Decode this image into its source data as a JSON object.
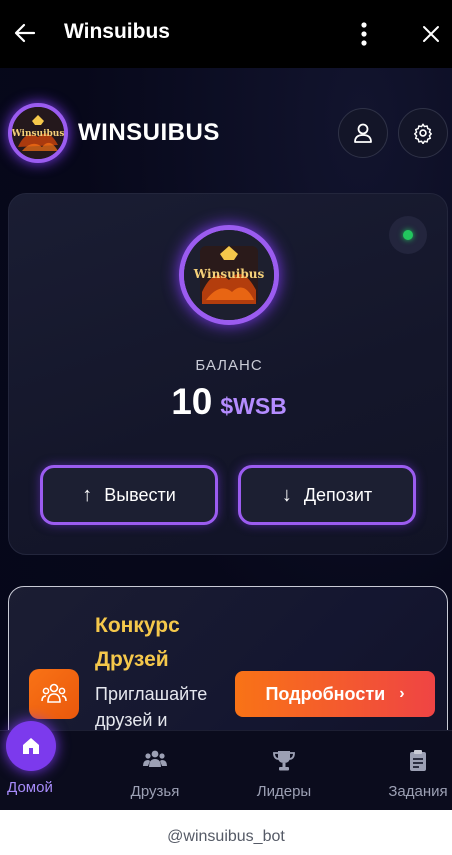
{
  "topbar": {
    "title": "Winsuibus",
    "back_icon": "arrow-left-icon",
    "more_icon": "more-vertical-icon",
    "close_icon": "close-icon"
  },
  "header": {
    "brand_name": "WINSUIBUS",
    "logo_icon": "winsuibus-logo",
    "logo_text": "Winsuibus",
    "profile_icon": "user-icon",
    "settings_icon": "gear-icon"
  },
  "balance": {
    "label": "БАЛАНС",
    "amount": "10",
    "currency": "$WSB",
    "status_color": "#22c55e",
    "withdraw_label": "Вывести",
    "deposit_label": "Депозит"
  },
  "promo": {
    "title": "Конкурс Друзей",
    "text": "Приглашайте друзей и",
    "button_label": "Подробности",
    "icon": "group-icon"
  },
  "nav": {
    "items": [
      {
        "label": "Домой",
        "icon": "home-icon",
        "active": true
      },
      {
        "label": "Друзья",
        "icon": "users-icon",
        "active": false
      },
      {
        "label": "Лидеры",
        "icon": "trophy-icon",
        "active": false
      },
      {
        "label": "Задания",
        "icon": "tasks-icon",
        "active": false
      }
    ]
  },
  "footer": {
    "bot_name": "@winsuibus_bot"
  },
  "colors": {
    "accent": "#9b5cf0",
    "currency": "#b48cff",
    "promo_title": "#f5c84b",
    "promo_button": "#f97316"
  }
}
